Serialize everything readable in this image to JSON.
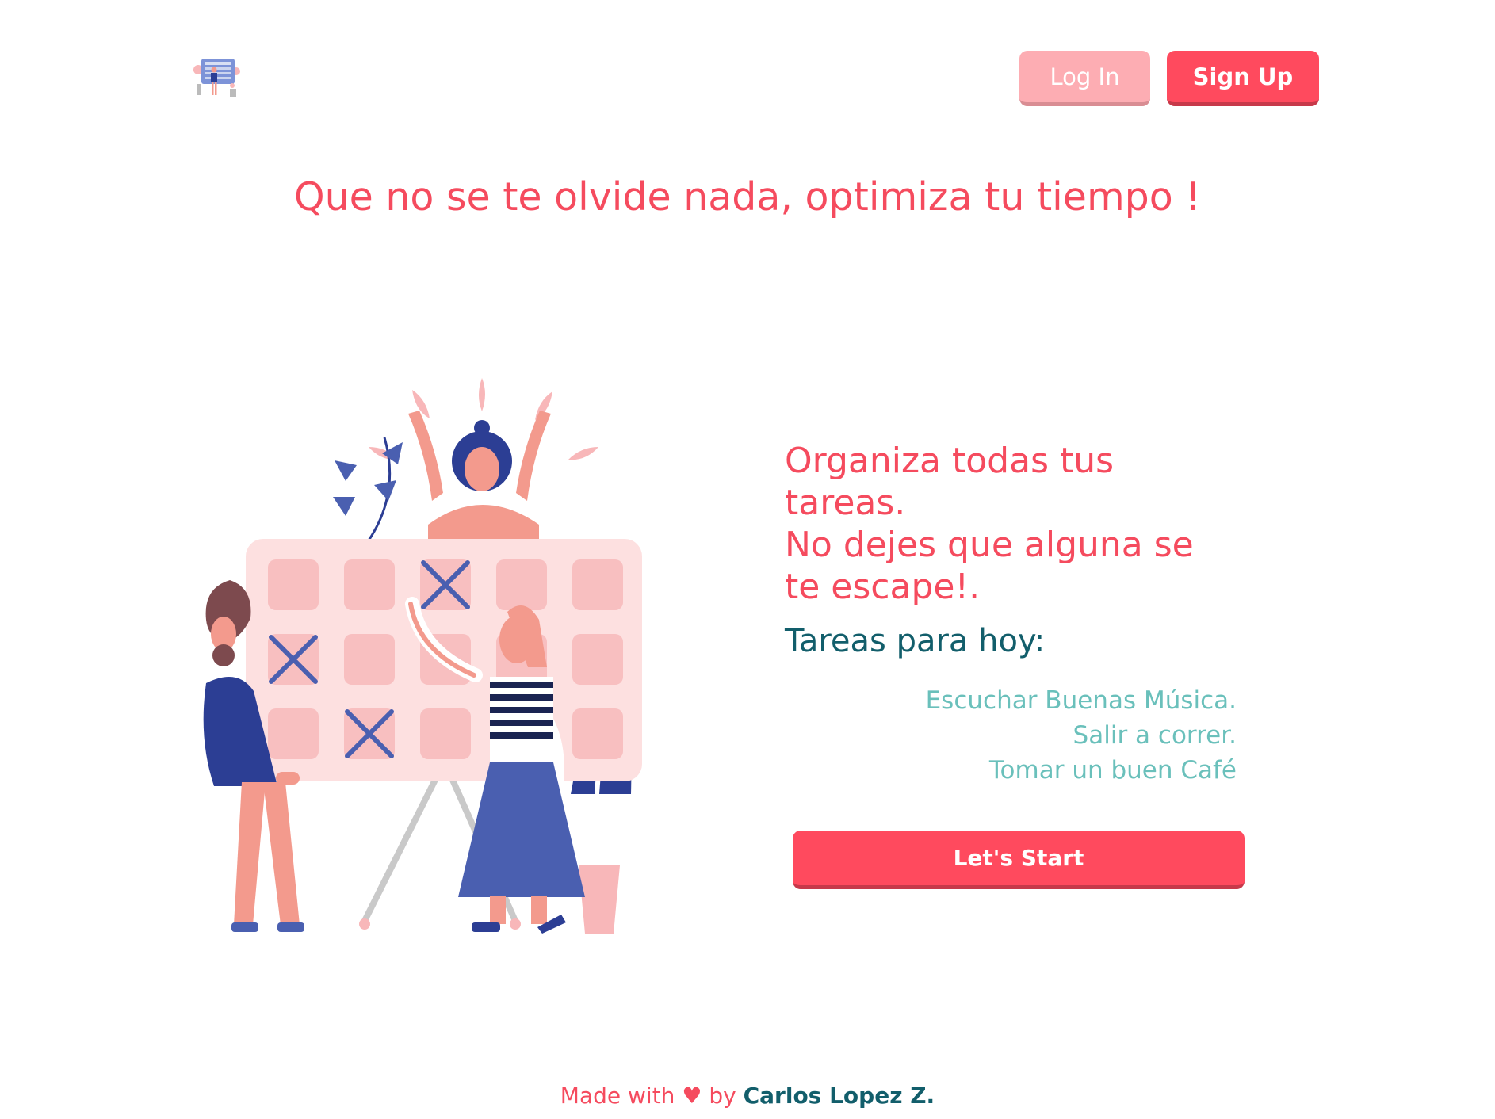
{
  "header": {
    "logo_icon": "calendar-logo-icon",
    "login_label": "Log In",
    "signup_label": "Sign Up"
  },
  "hero": {
    "title": "Que no se te olvide nada, optimiza tu tiempo !"
  },
  "illustration": {
    "icon": "calendar-people-illustration"
  },
  "main": {
    "organize_lines": [
      "Organiza todas tus",
      "tareas.",
      "No dejes que alguna se",
      "te escape!."
    ],
    "tasks_heading": "Tareas para hoy:",
    "tasks": [
      "Escuchar Buenas Música.",
      "Salir a correr.",
      "Tomar un buen Café"
    ],
    "start_label": "Let's Start"
  },
  "footer": {
    "made_with": "Made with",
    "heart": "♥",
    "by": "by",
    "author": "Carlos Lopez Z."
  },
  "colors": {
    "primary": "#ff4a5e",
    "primary_light": "#fdadb3",
    "teal_dark": "#125e6b",
    "teal_light": "#6ac0bb"
  }
}
